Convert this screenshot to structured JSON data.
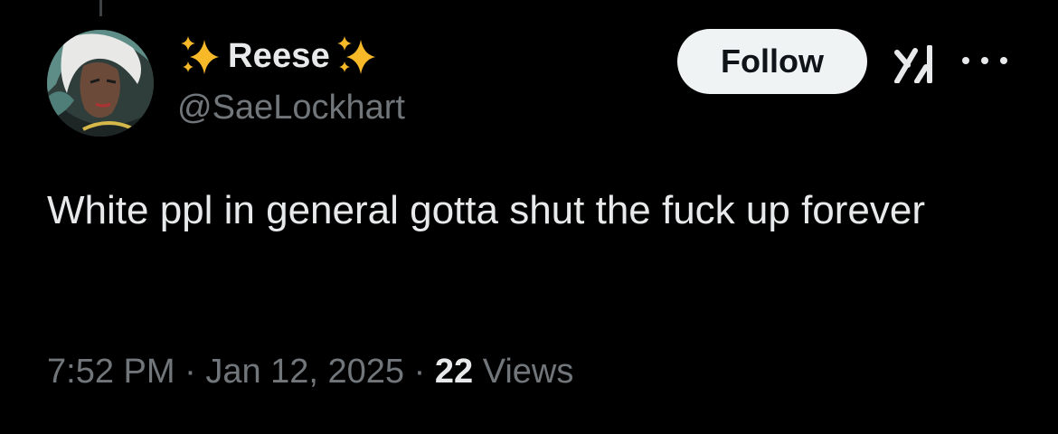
{
  "author": {
    "display_name": "Reese",
    "name_emoji": "sparkles",
    "handle": "@SaeLockhart",
    "avatar_icon": "avatar-storm-comic"
  },
  "actions": {
    "follow_label": "Follow",
    "grok_icon": "grok-icon",
    "more_icon": "more-options-icon"
  },
  "tweet": {
    "text": "White ppl in general gotta shut the fuck up forever",
    "time": "7:52 PM",
    "separator": "·",
    "date": "Jan 12, 2025",
    "views_count": "22",
    "views_label": "Views"
  },
  "colors": {
    "background": "#000000",
    "primary_text": "#e7e9ea",
    "secondary_text": "#71767b",
    "follow_button_bg": "#eff3f4",
    "sparkle": "#f7b928"
  }
}
